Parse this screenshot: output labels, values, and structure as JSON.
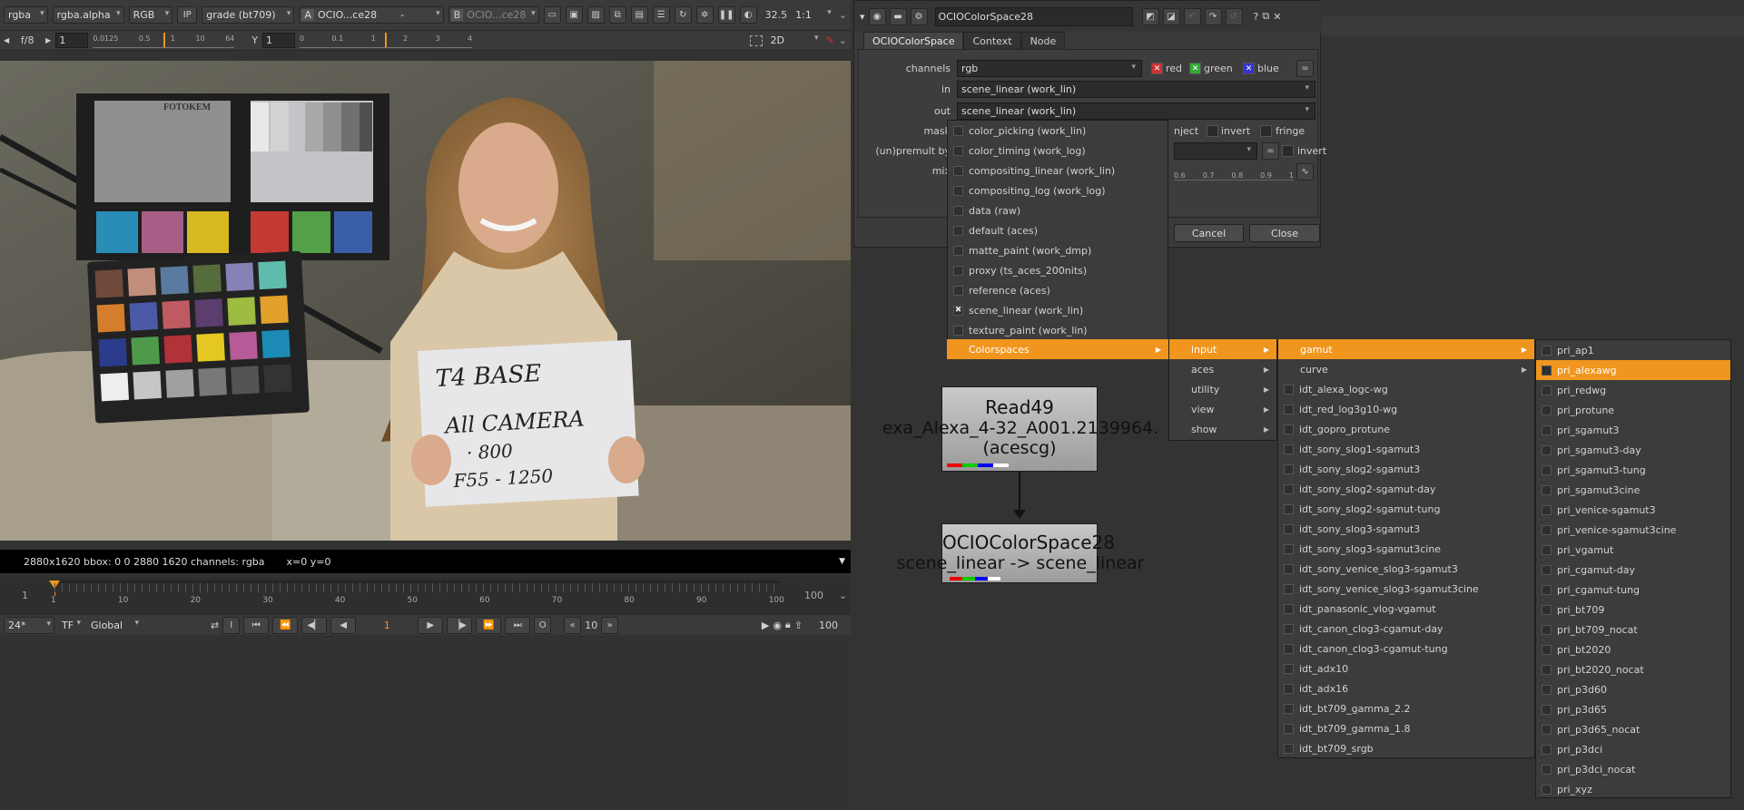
{
  "viewer": {
    "toolbar1": {
      "channels": "rgba",
      "alpha": "rgba.alpha",
      "colorspace": "RGB",
      "ip": "IP",
      "grade": "grade (bt709)",
      "a_label": "A",
      "a_input": "OCIO...ce28",
      "dash": "-",
      "b_label": "B",
      "b_input": "OCIO...ce28",
      "zoom": "32.5",
      "ratio": "1:1"
    },
    "toolbar2": {
      "fstop": "f/8",
      "gain": "1",
      "gain_ticks": [
        "0.0125",
        "0.5",
        "1",
        "10",
        "64"
      ],
      "y_label": "Y",
      "gamma": "1",
      "gamma_ticks": [
        "0",
        "0.1",
        "1",
        "2",
        "3",
        "4"
      ],
      "mode": "2D"
    },
    "info_format": "2880x1620  bbox: 0 0 2880 1620  channels: rgba",
    "info_coords": "x=0 y=0",
    "card": {
      "brand": "FOTOKEM",
      "line1": "T4 BASE",
      "line2": "All CAMERA",
      "line3": "· 800",
      "line4": "F55 - 1250"
    }
  },
  "timeline": {
    "start": "1",
    "end": "100",
    "end_right": "100",
    "ticks": [
      "1",
      "10",
      "20",
      "30",
      "40",
      "50",
      "60",
      "70",
      "80",
      "90",
      "100"
    ],
    "fps": "24*",
    "tf": "TF",
    "scope": "Global",
    "frame": "1",
    "step": "10",
    "in_label": "I",
    "out_label": "O"
  },
  "nodegraph": {
    "read_title": "Read49",
    "read_file": "exa_Alexa_4-32_A001.2139964.",
    "read_cs": "(acescg)",
    "ocio_title": "OCIOColorSpace28",
    "ocio_sub": "scene_linear -> scene_linear"
  },
  "dialog": {
    "name": "OCIOColorSpace28",
    "tabs": [
      "OCIOColorSpace",
      "Context",
      "Node"
    ],
    "channels_label": "channels",
    "channels_value": "rgb",
    "red": "red",
    "green": "green",
    "blue": "blue",
    "in_label": "in",
    "in_value": "scene_linear (work_lin)",
    "out_label": "out",
    "out_value": "scene_linear (work_lin)",
    "mask_label": "mask",
    "inject": "nject",
    "invert": "invert",
    "fringe": "fringe",
    "premult_label": "(un)premult by",
    "invert2": "invert",
    "mix_label": "mix",
    "mix_ticks": [
      "0.6",
      "0.7",
      "0.8",
      "0.9",
      "1"
    ],
    "cancel": "Cancel",
    "close": "Close"
  },
  "menu_roles": [
    {
      "label": "color_picking (work_lin)",
      "checked": false
    },
    {
      "label": "color_timing (work_log)",
      "checked": false
    },
    {
      "label": "compositing_linear (work_lin)",
      "checked": false
    },
    {
      "label": "compositing_log (work_log)",
      "checked": false
    },
    {
      "label": "data (raw)",
      "checked": false
    },
    {
      "label": "default (aces)",
      "checked": false
    },
    {
      "label": "matte_paint (work_dmp)",
      "checked": false
    },
    {
      "label": "proxy (ts_aces_200nits)",
      "checked": false
    },
    {
      "label": "reference (aces)",
      "checked": false
    },
    {
      "label": "scene_linear (work_lin)",
      "checked": true
    },
    {
      "label": "texture_paint (work_lin)",
      "checked": false
    }
  ],
  "menu_colorspaces": "Colorspaces",
  "menu_families": [
    "input",
    "aces",
    "utility",
    "view",
    "show"
  ],
  "menu_input": [
    "gamut",
    "curve"
  ],
  "menu_idt": [
    "idt_alexa_logc-wg",
    "idt_red_log3g10-wg",
    "idt_gopro_protune",
    "idt_sony_slog1-sgamut3",
    "idt_sony_slog2-sgamut3",
    "idt_sony_slog2-sgamut-day",
    "idt_sony_slog2-sgamut-tung",
    "idt_sony_slog3-sgamut3",
    "idt_sony_slog3-sgamut3cine",
    "idt_sony_venice_slog3-sgamut3",
    "idt_sony_venice_slog3-sgamut3cine",
    "idt_panasonic_vlog-vgamut",
    "idt_canon_clog3-cgamut-day",
    "idt_canon_clog3-cgamut-tung",
    "idt_adx10",
    "idt_adx16",
    "idt_bt709_gamma_2.2",
    "idt_bt709_gamma_1.8",
    "idt_bt709_srgb"
  ],
  "menu_gamut": [
    "pri_ap1",
    "pri_alexawg",
    "pri_redwg",
    "pri_protune",
    "pri_sgamut3",
    "pri_sgamut3-day",
    "pri_sgamut3-tung",
    "pri_sgamut3cine",
    "pri_venice-sgamut3",
    "pri_venice-sgamut3cine",
    "pri_vgamut",
    "pri_cgamut-day",
    "pri_cgamut-tung",
    "pri_bt709",
    "pri_bt709_nocat",
    "pri_bt2020",
    "pri_bt2020_nocat",
    "pri_p3d60",
    "pri_p3d65",
    "pri_p3d65_nocat",
    "pri_p3dci",
    "pri_p3dci_nocat",
    "pri_xyz"
  ],
  "colors": {
    "accent": "#f0961e",
    "panel": "#3a3a3a",
    "background": "#323232"
  }
}
